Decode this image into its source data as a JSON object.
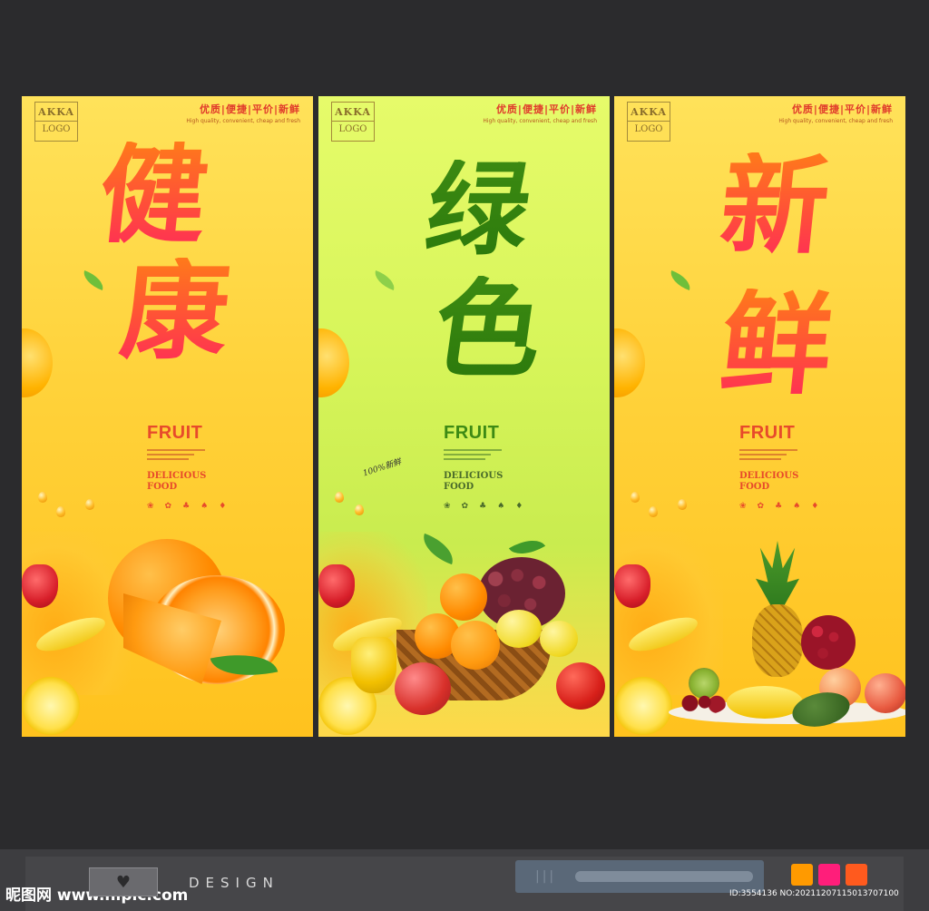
{
  "posters": [
    {
      "logo_top": "AKKA",
      "logo_bottom": "LOGO",
      "tagline_cn": "优质|便捷|平价|新鲜",
      "tagline_en": "High quality, convenient, cheap and fresh",
      "char1": "健",
      "char2": "康",
      "fruit": "FRUIT",
      "delicious_line1": "DELICIOUS",
      "delicious_line2": "FOOD"
    },
    {
      "logo_top": "AKKA",
      "logo_bottom": "LOGO",
      "tagline_cn": "优质|便捷|平价|新鲜",
      "tagline_en": "High quality, convenient, cheap and fresh",
      "char1": "绿",
      "char2": "色",
      "fruit": "FRUIT",
      "handwritten": "100%新鲜",
      "delicious_line1": "DELICIOUS",
      "delicious_line2": "FOOD"
    },
    {
      "logo_top": "AKKA",
      "logo_bottom": "LOGO",
      "tagline_cn": "优质|便捷|平价|新鲜",
      "tagline_en": "High quality, convenient, cheap and fresh",
      "char1": "新",
      "char2": "鲜",
      "fruit": "FRUIT",
      "delicious_line1": "DELICIOUS",
      "delicious_line2": "FOOD"
    }
  ],
  "bottom": {
    "brand": "昵图网 www.nipic.com",
    "design_label": "DESIGN",
    "image_id": "ID:3554136 NO:20211207115013707100",
    "heart_icon": "heart-icon",
    "swatches": [
      "#ff9a00",
      "#ff1e7a",
      "#ff5a1e"
    ]
  }
}
